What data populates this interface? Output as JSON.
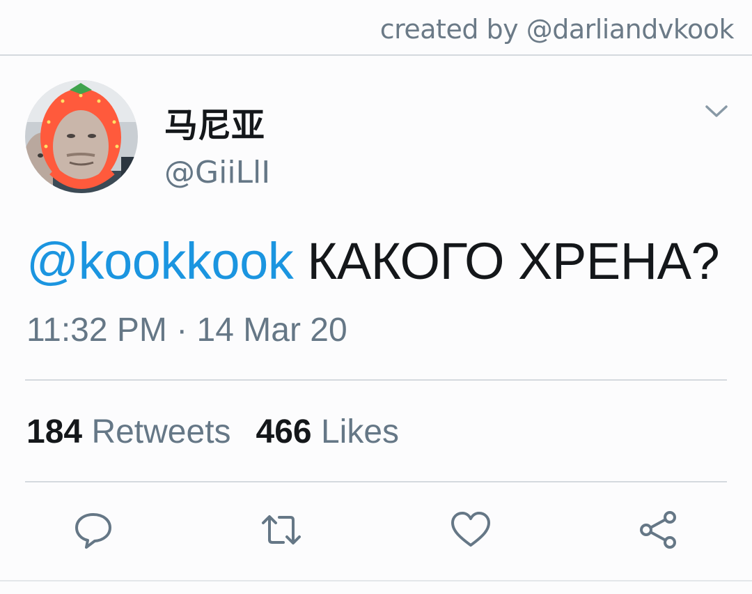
{
  "credit": "created by @darliandvkook",
  "tweet": {
    "author": {
      "display_name": "马尼亚",
      "handle": "@GiiLlI"
    },
    "mention": "@kookkook",
    "text": " КАКОГО ХРЕНА?",
    "timestamp": "11:32 PM · 14 Mar 20",
    "stats": {
      "retweets_count": "184",
      "retweets_label": "Retweets",
      "likes_count": "466",
      "likes_label": "Likes"
    }
  },
  "icons": {
    "more": "chevron-down-icon",
    "reply": "reply-icon",
    "retweet": "retweet-icon",
    "like": "heart-icon",
    "share": "share-icon"
  },
  "colors": {
    "mention": "#1b95e0",
    "secondary_text": "#657786",
    "primary_text": "#14171a",
    "divider": "#d4d9de"
  }
}
